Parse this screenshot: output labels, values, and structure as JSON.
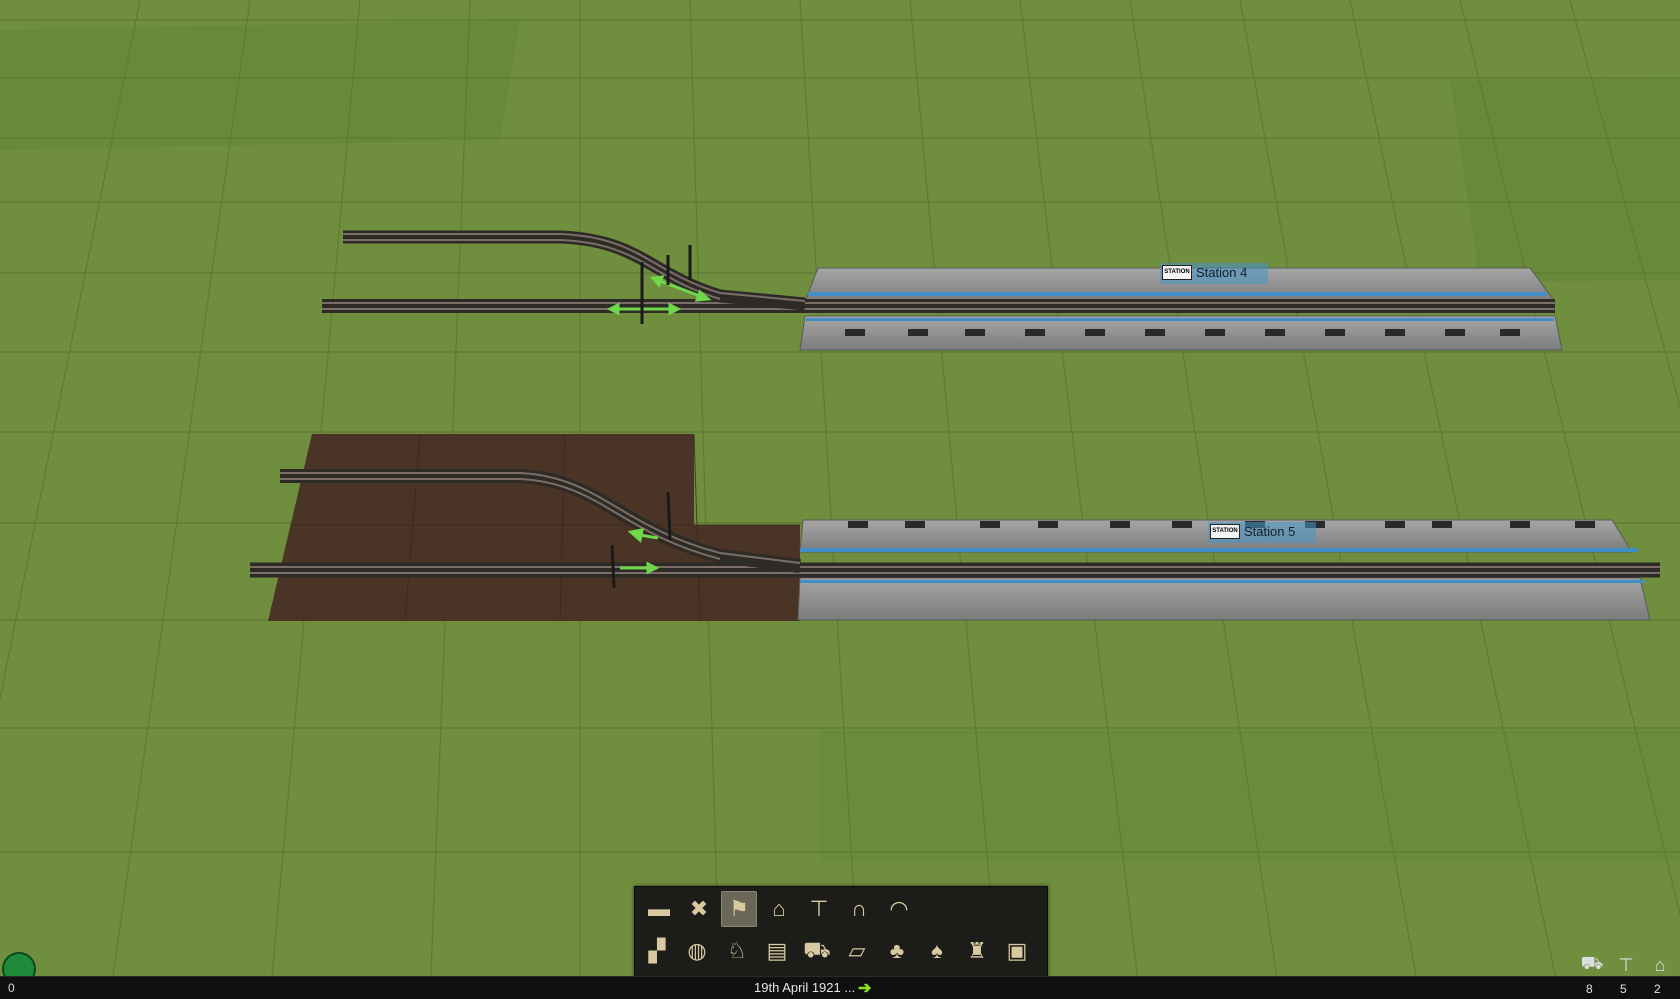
{
  "stations": [
    {
      "name": "Station 4",
      "sign": "STATION"
    },
    {
      "name": "Station 5",
      "sign": "STATION"
    }
  ],
  "toolbar": {
    "row1": [
      {
        "name": "track-tool-icon",
        "glyph": "▬"
      },
      {
        "name": "demolish-track-icon",
        "glyph": "✖"
      },
      {
        "name": "signal-tool-icon",
        "glyph": "⚑"
      },
      {
        "name": "depot-icon",
        "glyph": "⌂"
      },
      {
        "name": "station-tool-icon",
        "glyph": "⊤"
      },
      {
        "name": "bridge-icon",
        "glyph": "∩"
      },
      {
        "name": "tunnel-icon",
        "glyph": "◠"
      }
    ],
    "row2": [
      {
        "name": "terrain-tool-icon",
        "glyph": "▞"
      },
      {
        "name": "waypoint-icon",
        "glyph": "◍"
      },
      {
        "name": "bird-icon",
        "glyph": "♘"
      },
      {
        "name": "track-build-icon",
        "glyph": "▤"
      },
      {
        "name": "bulldozer-icon",
        "glyph": "⛟"
      },
      {
        "name": "road-icon",
        "glyph": "▱"
      },
      {
        "name": "pine-tree-icon",
        "glyph": "♣"
      },
      {
        "name": "deciduous-tree-icon",
        "glyph": "♠"
      },
      {
        "name": "top-hat-icon",
        "glyph": "♜"
      },
      {
        "name": "computer-icon",
        "glyph": "▣"
      }
    ],
    "active_index": 3
  },
  "status": {
    "money": "0",
    "date": "19th April 1921 ...",
    "date_arrow": "➔",
    "counts": {
      "trains": "8",
      "stations": "5",
      "depots": "2"
    }
  },
  "colors": {
    "grass": "#6f8f3e",
    "dirt": "#4a3426",
    "platform": "#8e8e8e",
    "rail": "#3a3530",
    "signal_arrow": "#6fd84a",
    "station_highlight": "#4696c8"
  }
}
